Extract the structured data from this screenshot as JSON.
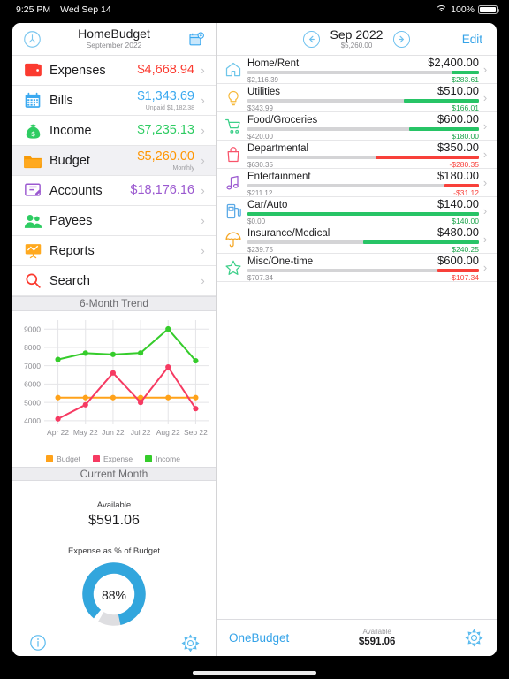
{
  "statusbar": {
    "time": "9:25 PM",
    "date": "Wed Sep 14",
    "battery": "100%",
    "wifi_icon": "wifi-icon",
    "battery_icon": "battery-icon"
  },
  "left": {
    "header": {
      "title": "HomeBudget",
      "subtitle": "September 2022",
      "left_icon": "clock-icon",
      "right_icon": "calendar-add-icon"
    },
    "menu": [
      {
        "label": "Expenses",
        "value": "$4,668.94",
        "sub": "",
        "color": "#fb3b30",
        "icon": "wallet-icon",
        "selected": false
      },
      {
        "label": "Bills",
        "value": "$1,343.69",
        "sub": "Unpaid $1,182.38",
        "color": "#3ba9f0",
        "icon": "calendar-icon",
        "selected": false
      },
      {
        "label": "Income",
        "value": "$7,235.13",
        "sub": "",
        "color": "#2ecc62",
        "icon": "money-bag-icon",
        "selected": false
      },
      {
        "label": "Budget",
        "value": "$5,260.00",
        "sub": "Monthly",
        "color": "#ff9500",
        "icon": "folder-icon",
        "selected": true
      },
      {
        "label": "Accounts",
        "value": "$18,176.16",
        "sub": "",
        "color": "#9b59d0",
        "icon": "register-icon",
        "selected": false
      },
      {
        "label": "Payees",
        "value": "",
        "sub": "",
        "color": "#2ecc62",
        "icon": "people-icon",
        "selected": false
      },
      {
        "label": "Reports",
        "value": "",
        "sub": "",
        "color": "#ff9500",
        "icon": "reports-icon",
        "selected": false
      },
      {
        "label": "Search",
        "value": "",
        "sub": "",
        "color": "#fb3b30",
        "icon": "search-icon",
        "selected": false
      }
    ],
    "trend_header": "6-Month Trend",
    "current_month": {
      "header": "Current Month",
      "available_label": "Available",
      "available_value": "$591.06",
      "gauge_label": "Expense as % of Budget",
      "gauge_value": "88%",
      "gauge_pct": 88,
      "gauge_color": "#32a6dd",
      "gauge_track": "#dedee1"
    },
    "bottom": {
      "info_icon": "info-circle-icon",
      "gear_icon": "gear-icon"
    }
  },
  "chart_data": {
    "type": "line",
    "title": "6-Month Trend",
    "categories": [
      "Apr 22",
      "May 22",
      "Jun 22",
      "Jul 22",
      "Aug 22",
      "Sep 22"
    ],
    "series": [
      {
        "name": "Budget",
        "color": "#ffa21a",
        "values": [
          5260,
          5260,
          5260,
          5260,
          5260,
          5260
        ]
      },
      {
        "name": "Expense",
        "color": "#f63a62",
        "values": [
          4100,
          4870,
          6610,
          5000,
          6930,
          4660
        ]
      },
      {
        "name": "Income",
        "color": "#35cc2b",
        "values": [
          7340,
          7690,
          7620,
          7700,
          9010,
          7270
        ]
      }
    ],
    "yticks": [
      4000,
      5000,
      6000,
      7000,
      8000,
      9000
    ],
    "ylim": [
      3800,
      9300
    ],
    "xlabel": "",
    "ylabel": "",
    "grid": true,
    "legend_position": "bottom"
  },
  "right": {
    "header": {
      "prev_icon": "arrow-left-circle-icon",
      "next_icon": "arrow-right-circle-icon",
      "title": "Sep 2022",
      "subtitle": "$5,260.00",
      "edit_label": "Edit"
    },
    "rows": [
      {
        "name": "Home/Rent",
        "budget": "$2,400.00",
        "spent": "$2,116.39",
        "remaining": "$283.61",
        "over": false,
        "spent_pct": 88.2,
        "icon": "house-icon",
        "icon_color": "#6fc6ea"
      },
      {
        "name": "Utilities",
        "budget": "$510.00",
        "spent": "$343.99",
        "remaining": "$166.01",
        "over": false,
        "spent_pct": 67.4,
        "icon": "bulb-icon",
        "icon_color": "#f6b93b"
      },
      {
        "name": "Food/Groceries",
        "budget": "$600.00",
        "spent": "$420.00",
        "remaining": "$180.00",
        "over": false,
        "spent_pct": 70.0,
        "icon": "cart-icon",
        "icon_color": "#3ed08a"
      },
      {
        "name": "Departmental",
        "budget": "$350.00",
        "spent": "$630.35",
        "remaining": "-$280.35",
        "over": true,
        "spent_pct": 55.5,
        "icon": "bag-icon",
        "icon_color": "#f8546b"
      },
      {
        "name": "Entertainment",
        "budget": "$180.00",
        "spent": "$211.12",
        "remaining": "-$31.12",
        "over": true,
        "spent_pct": 85.3,
        "icon": "music-icon",
        "icon_color": "#9b59d0"
      },
      {
        "name": "Car/Auto",
        "budget": "$140.00",
        "spent": "$0.00",
        "remaining": "$140.00",
        "over": false,
        "spent_pct": 0.0,
        "icon": "fuel-icon",
        "icon_color": "#5aa9e6"
      },
      {
        "name": "Insurance/Medical",
        "budget": "$480.00",
        "spent": "$239.75",
        "remaining": "$240.25",
        "over": false,
        "spent_pct": 50.0,
        "icon": "umbrella-icon",
        "icon_color": "#f5a623"
      },
      {
        "name": "Misc/One-time",
        "budget": "$600.00",
        "spent": "$707.34",
        "remaining": "-$107.34",
        "over": true,
        "spent_pct": 82.0,
        "icon": "star-icon",
        "icon_color": "#3ed08a"
      }
    ],
    "bottom": {
      "onebudget_label": "OneBudget",
      "available_label": "Available",
      "available_value": "$591.06",
      "gear_icon": "gear-icon"
    }
  },
  "colors": {
    "green": "#27c466",
    "red": "#f8403a",
    "blue": "#35a3e8",
    "gray": "#d4d4d6"
  }
}
